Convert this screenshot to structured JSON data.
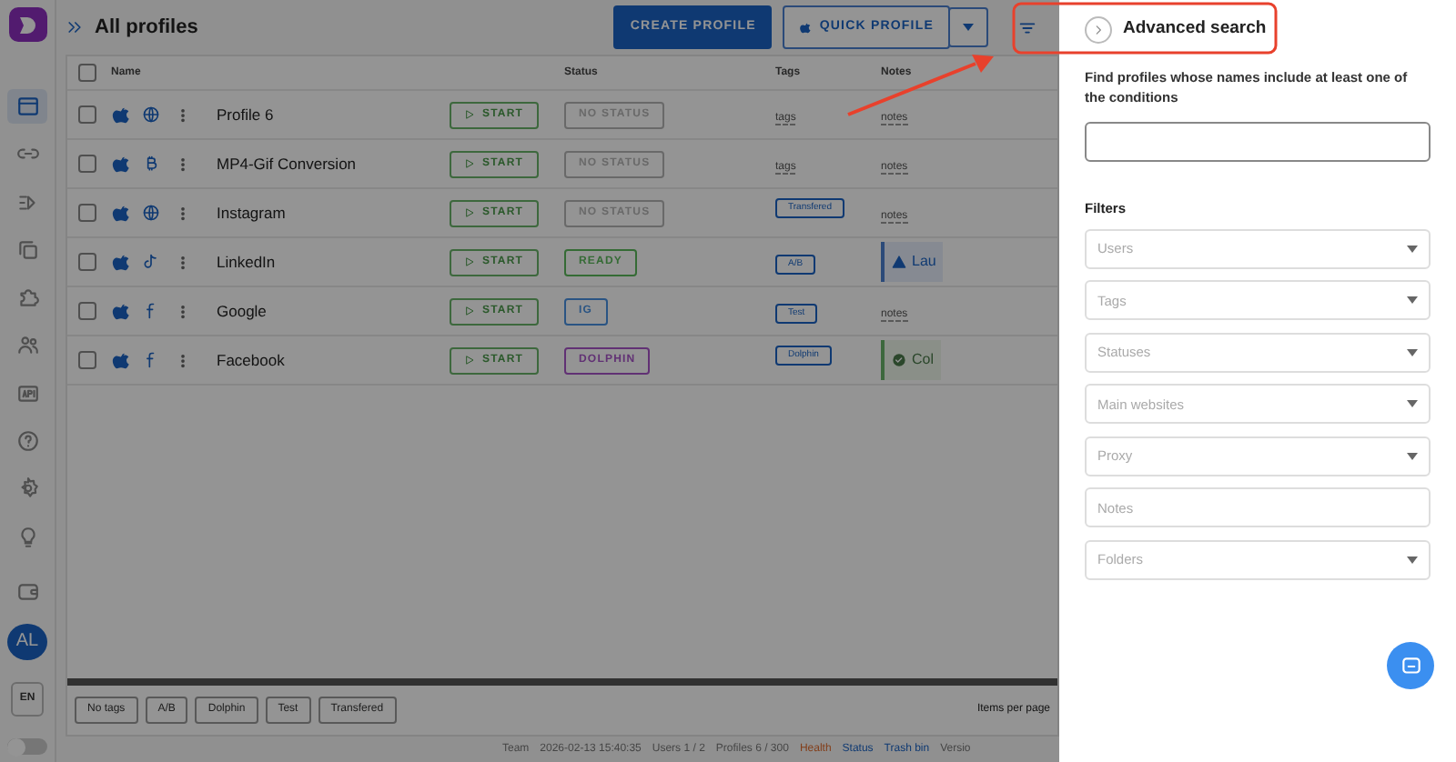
{
  "sidebar": {
    "items": [
      {
        "selected": true
      },
      {
        "selected": false
      },
      {
        "selected": false
      },
      {
        "selected": false
      },
      {
        "selected": false
      },
      {
        "selected": false
      },
      {
        "selected": false
      },
      {
        "selected": false
      },
      {
        "selected": false
      },
      {
        "selected": false
      },
      {
        "selected": false
      }
    ],
    "avatar": "AL",
    "language": "EN",
    "dark_mode": {
      "on": false
    }
  },
  "header": {
    "title": "All profiles",
    "create_button": "CREATE PROFILE",
    "quick_button": "QUICK PROFILE"
  },
  "table": {
    "select_all": {
      "checked": false
    },
    "columns": [
      "Name",
      "Status",
      "Tags",
      "Notes"
    ],
    "rows": [
      {
        "checked": false,
        "name": "Profile 6",
        "start": "START",
        "status": {
          "text": "NO STATUS",
          "color": "#696969"
        },
        "tags": {
          "kind": "link",
          "text": "tags"
        },
        "notes": {
          "kind": "link",
          "text": "notes"
        }
      },
      {
        "checked": false,
        "name": "MP4-Gif Conversion",
        "start": "START",
        "status": {
          "text": "NO STATUS",
          "color": "#696969"
        },
        "tags": {
          "kind": "link",
          "text": "tags"
        },
        "notes": {
          "kind": "link",
          "text": "notes"
        }
      },
      {
        "checked": false,
        "name": "Instagram",
        "start": "START",
        "status": {
          "text": "NO STATUS",
          "color": "#696969"
        },
        "tags": {
          "kind": "tag",
          "text": "Transfered"
        },
        "notes": {
          "kind": "link",
          "text": "notes"
        }
      },
      {
        "checked": false,
        "name": "LinkedIn",
        "start": "START",
        "status": {
          "text": "READY",
          "color": "#356b35"
        },
        "tags": {
          "kind": "tag",
          "text": "A/B"
        },
        "notes": {
          "kind": "warning",
          "text": "Lau"
        }
      },
      {
        "checked": false,
        "name": "Google",
        "start": "START",
        "status": {
          "text": "IG",
          "color": "#2a5483"
        },
        "tags": {
          "kind": "tag",
          "text": "Test"
        },
        "notes": {
          "kind": "link",
          "text": "notes"
        }
      },
      {
        "checked": false,
        "name": "Facebook",
        "start": "START",
        "status": {
          "text": "DOLPHIN",
          "color": "#613174"
        },
        "tags": {
          "kind": "tag",
          "text": "Dolphin"
        },
        "notes": {
          "kind": "success",
          "text": "Col"
        }
      }
    ]
  },
  "tag_filters": [
    "No tags",
    "A/B",
    "Dolphin",
    "Test",
    "Transfered"
  ],
  "items_per_page": "Items per page",
  "status_bar": [
    {
      "kind": "text",
      "text": "Team"
    },
    {
      "kind": "text",
      "text": "2026-02-13 15:40:35"
    },
    {
      "kind": "text",
      "text": "Users 1 / 2"
    },
    {
      "kind": "text",
      "text": "Profiles 6 / 300"
    },
    {
      "kind": "warn-link",
      "text": "Health"
    },
    {
      "kind": "link",
      "text": "Status"
    },
    {
      "kind": "link",
      "text": "Trash bin"
    },
    {
      "kind": "text",
      "text": "Versio"
    }
  ],
  "drawer": {
    "title": "Advanced search",
    "description": "Find profiles whose names include at least one of the conditions",
    "filters_title": "Filters",
    "filters": [
      {
        "kind": "select",
        "placeholder": "Users"
      },
      {
        "kind": "select",
        "placeholder": "Tags"
      },
      {
        "kind": "select",
        "placeholder": "Statuses"
      },
      {
        "kind": "select",
        "placeholder": "Main websites"
      },
      {
        "kind": "select",
        "placeholder": "Proxy"
      },
      {
        "kind": "text",
        "placeholder": "Notes"
      },
      {
        "kind": "select",
        "placeholder": "Folders"
      }
    ]
  }
}
